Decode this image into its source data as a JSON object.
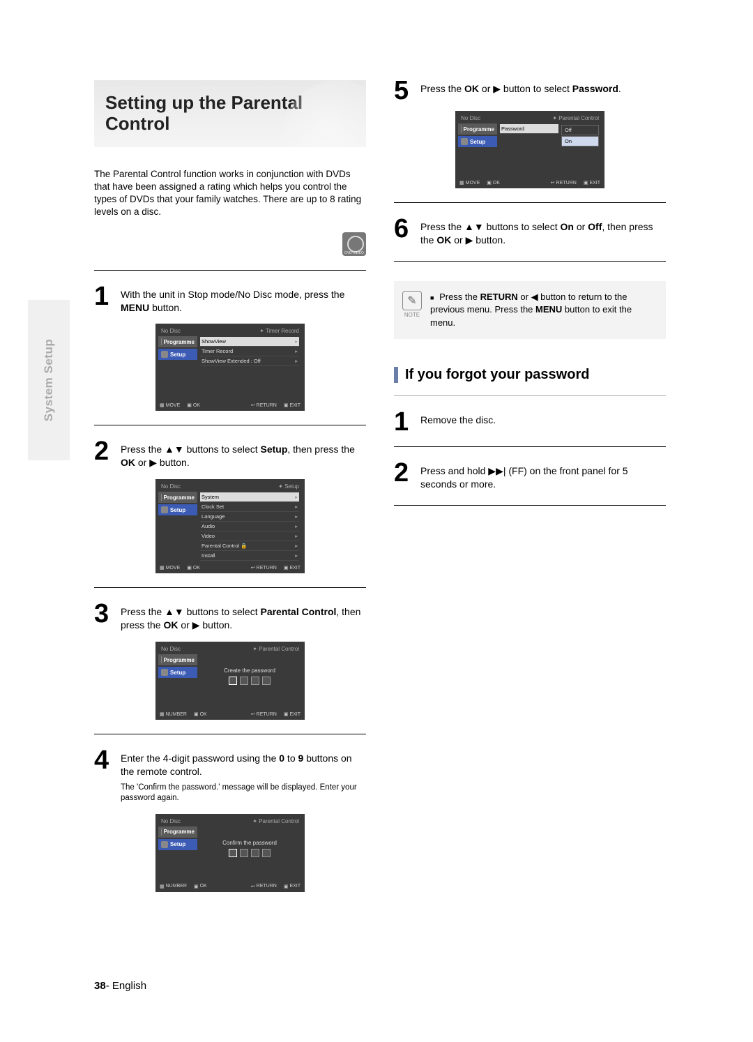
{
  "sideTab": "System Setup",
  "title": "Setting up the Parental Control",
  "intro": "The Parental Control function works in conjunction with DVDs that have been assigned a rating which helps you control the types of DVDs that your family watches. There are up to 8 rating levels on a disc.",
  "discIconName": "dvd-video-icon",
  "steps": {
    "s1": {
      "num": "1",
      "pre": "With the unit in Stop mode/No Disc mode, press the ",
      "b1": "MENU",
      "post": " button."
    },
    "s2": {
      "num": "2",
      "t1": "Press the ",
      "t2": " buttons to select ",
      "b1": "Setup",
      "t3": ", then press the ",
      "b2": "OK",
      "t4": " or ",
      "t5": " button."
    },
    "s3": {
      "num": "3",
      "t1": "Press the ",
      "t2": " buttons to select ",
      "b1": "Parental Control",
      "t3": ", then press the ",
      "b2": "OK",
      "t4": " or ",
      "t5": " button."
    },
    "s4": {
      "num": "4",
      "t1": "Enter the 4-digit password using the ",
      "b1": "0",
      "t2": " to ",
      "b2": "9",
      "t3": " buttons on the remote control.",
      "sub": "The 'Confirm the password.' message will be displayed. Enter your password again."
    },
    "s5": {
      "num": "5",
      "t1": "Press the ",
      "b1": "OK",
      "t2": " or ",
      "t3": " button to select ",
      "b2": "Password",
      "t4": "."
    },
    "s6": {
      "num": "6",
      "t1": "Press the ",
      "t2": " buttons to select ",
      "b1": "On",
      "t3": " or ",
      "b2": "Off",
      "t4": ", then press the ",
      "b3": "OK",
      "t5": " or ",
      "t6": " button."
    }
  },
  "note": {
    "label": "NOTE",
    "t1": "Press the ",
    "b1": "RETURN",
    "t2": " or ",
    "t3": " button to return to the previous menu. Press the ",
    "b2": "MENU",
    "t4": " button to exit the menu."
  },
  "forgot": {
    "heading": "If you forgot your password",
    "s1": {
      "num": "1",
      "text": "Remove the disc."
    },
    "s2": {
      "num": "2",
      "t1": "Press and hold ",
      "t2": " (FF) on the front panel for 5 seconds or more."
    }
  },
  "glyphs": {
    "upDown": "▲▼",
    "right": "▶",
    "left": "◀",
    "ff": "▶▶|"
  },
  "osd": {
    "noDisc": "No Disc",
    "programme": "Programme",
    "setup": "Setup",
    "move": "MOVE",
    "ok": "OK",
    "return": "RETURN",
    "exit": "EXIT",
    "number": "NUMBER",
    "screen1": {
      "crumb": "Timer Record",
      "items": [
        "ShowView",
        "Timer Record",
        "ShowView Extended : Off"
      ]
    },
    "screen2": {
      "crumb": "Setup",
      "head": "System",
      "items": [
        "Clock Set",
        "Language",
        "Audio",
        "Video",
        "Parental Control",
        "Install"
      ],
      "lockIdx": 4
    },
    "screen3": {
      "crumb": "Parental Control",
      "center": "Create the password"
    },
    "screen4": {
      "crumb": "Parental Control",
      "center": "Confirm the password"
    },
    "screen5": {
      "crumb": "Parental Control",
      "label": "Password",
      "opts": [
        "Off",
        "On"
      ],
      "sel": 1
    }
  },
  "footer": {
    "page": "38",
    "sep": "- ",
    "lang": "English"
  }
}
